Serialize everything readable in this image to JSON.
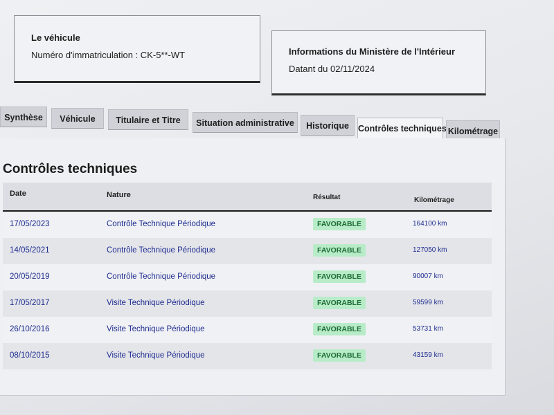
{
  "vehicle": {
    "title": "Le véhicule",
    "registration": "Numéro d'immatriculation : CK-5**-WT"
  },
  "ministry": {
    "title": "Informations du Ministère de l'Intérieur",
    "date": "Datant du 02/11/2024"
  },
  "tabs": [
    {
      "label": "Synthèse",
      "active": false
    },
    {
      "label": "Véhicule",
      "active": false
    },
    {
      "label": "Titulaire et Titre",
      "active": false
    },
    {
      "label": "Situation administrative",
      "active": false
    },
    {
      "label": "Historique",
      "active": false
    },
    {
      "label": "Contrôles techniques",
      "active": true
    },
    {
      "label": "Kilométrage",
      "active": false
    }
  ],
  "section_title": "Contrôles techniques",
  "table": {
    "headers": {
      "date": "Date",
      "nature": "Nature",
      "result": "Résultat",
      "km": "Kilométrage"
    },
    "rows": [
      {
        "date": "17/05/2023",
        "nature": "Contrôle Technique Périodique",
        "result": "FAVORABLE",
        "km": "164100 km"
      },
      {
        "date": "14/05/2021",
        "nature": "Contrôle Technique Périodique",
        "result": "FAVORABLE",
        "km": "127050 km"
      },
      {
        "date": "20/05/2019",
        "nature": "Contrôle Technique Périodique",
        "result": "FAVORABLE",
        "km": "90007 km"
      },
      {
        "date": "17/05/2017",
        "nature": "Visite Technique Périodique",
        "result": "FAVORABLE",
        "km": "59599 km"
      },
      {
        "date": "26/10/2016",
        "nature": "Visite Technique Périodique",
        "result": "FAVORABLE",
        "km": "53731 km"
      },
      {
        "date": "08/10/2015",
        "nature": "Visite Technique Périodique",
        "result": "FAVORABLE",
        "km": "43159 km"
      }
    ]
  },
  "colors": {
    "favorable_bg": "#b8ecc8",
    "favorable_text": "#1c6b33",
    "link_blue": "#1d2b8f"
  }
}
